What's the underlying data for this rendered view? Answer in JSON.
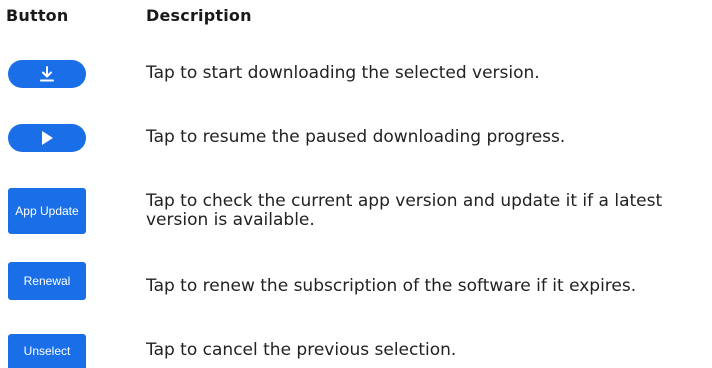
{
  "header": {
    "button_col": "Button",
    "description_col": "Description"
  },
  "rows": [
    {
      "button_icon": "download-icon",
      "description": "Tap to start downloading the selected version."
    },
    {
      "button_icon": "play-icon",
      "description": "Tap to resume the paused downloading progress."
    },
    {
      "button_label": "App Update",
      "description": "Tap to check the current app version and update it if a latest version is available."
    },
    {
      "button_label": "Renewal",
      "description": "Tap to renew the subscription of the software if it expires."
    },
    {
      "button_label": "Unselect",
      "description": "Tap to cancel the previous selection."
    }
  ],
  "colors": {
    "button_blue": "#1a6fe8",
    "text": "#222222"
  }
}
